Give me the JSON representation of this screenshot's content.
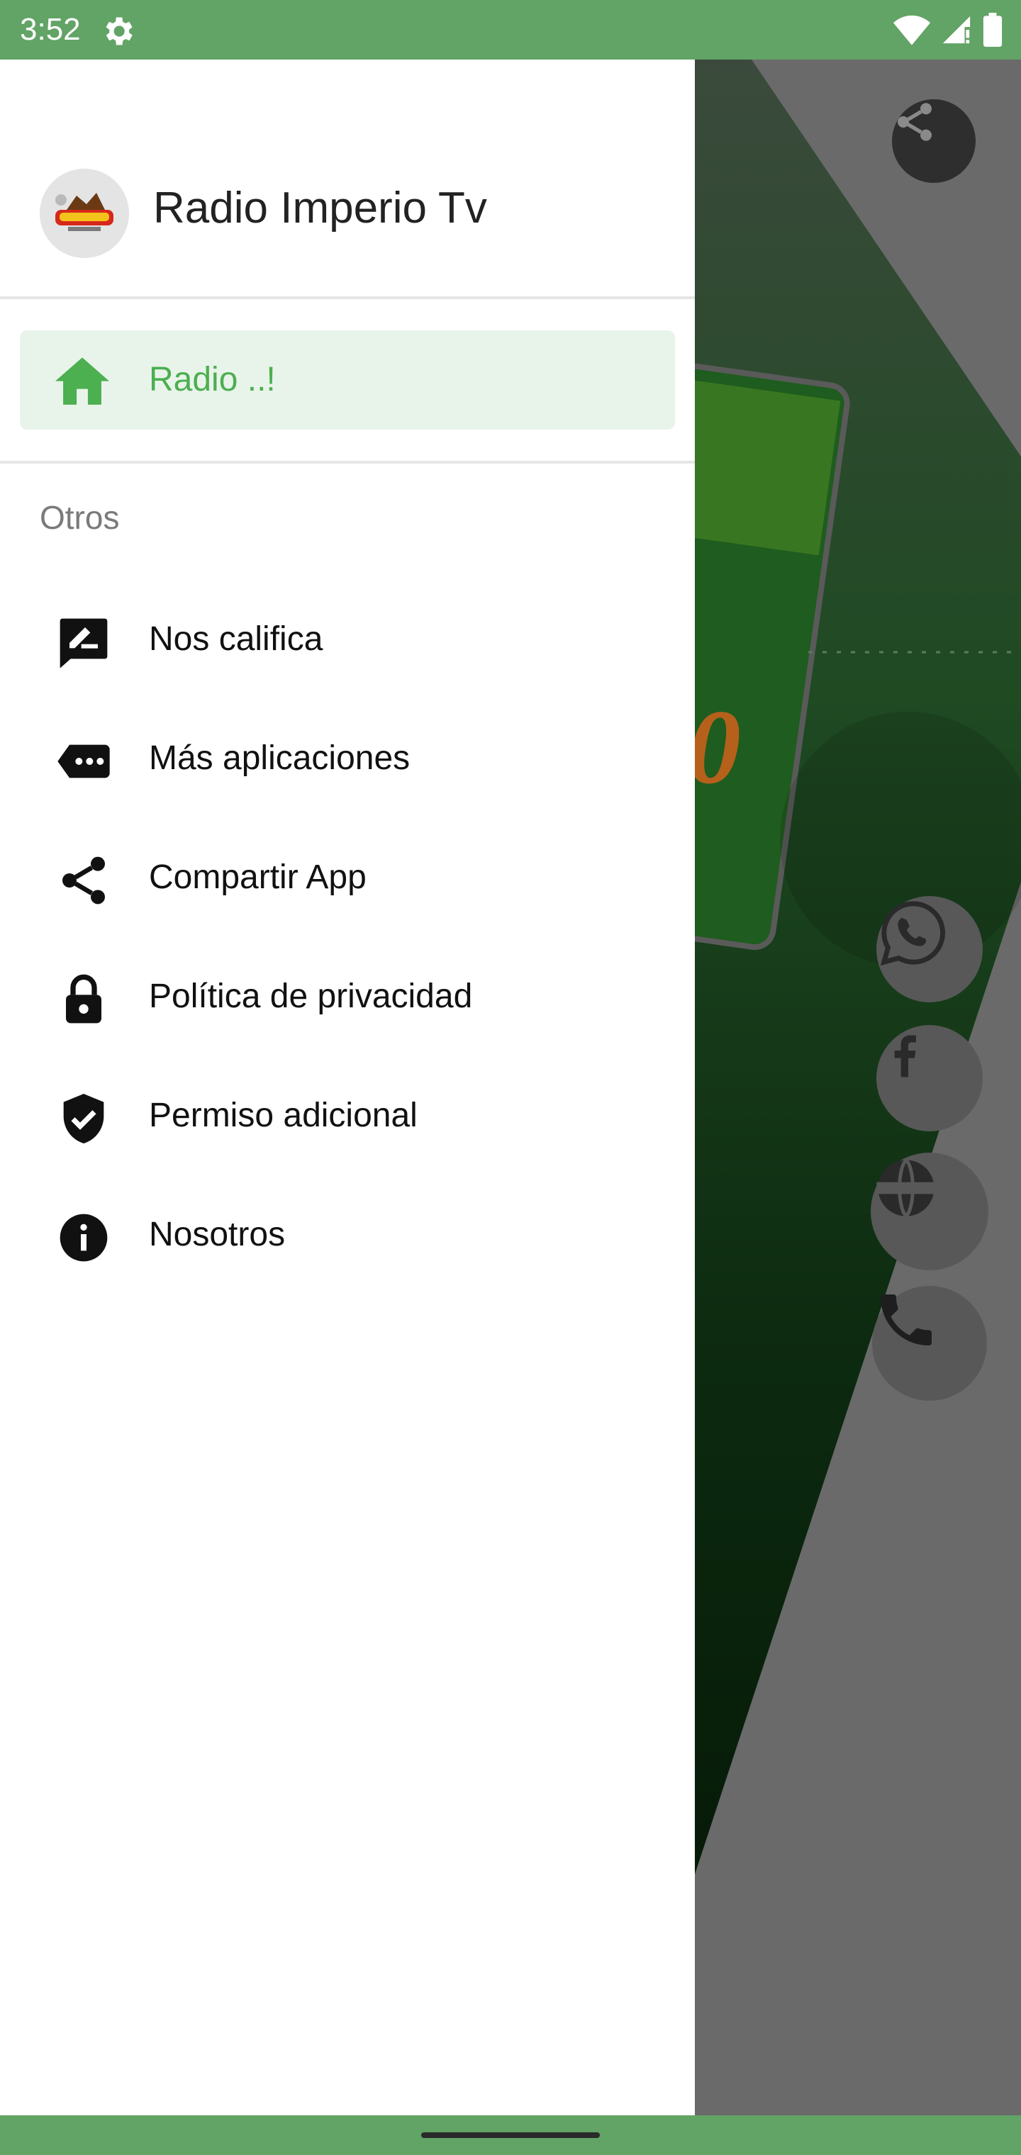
{
  "status_bar": {
    "time": "3:52"
  },
  "drawer": {
    "app_title": "Radio Imperio Tv",
    "selected_item": {
      "label": "Radio ..!",
      "icon": "home-icon"
    },
    "section_title": "Otros",
    "items": [
      {
        "label": "Nos califica",
        "icon": "rate-review-icon"
      },
      {
        "label": "Más aplicaciones",
        "icon": "more-apps-icon"
      },
      {
        "label": "Compartir App",
        "icon": "share-icon"
      },
      {
        "label": "Política de privacidad",
        "icon": "lock-icon"
      },
      {
        "label": "Permiso adicional",
        "icon": "verified-shield-icon"
      },
      {
        "label": "Nosotros",
        "icon": "info-icon"
      }
    ]
  },
  "colors": {
    "accent": "#4caf50",
    "status_bar": "#62a366",
    "selected_bg": "#e8f4ea"
  }
}
